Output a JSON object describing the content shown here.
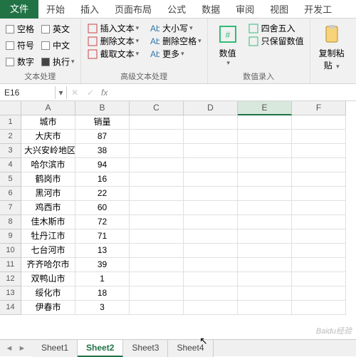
{
  "tabs": {
    "file": "文件",
    "items": [
      "开始",
      "插入",
      "页面布局",
      "公式",
      "数据",
      "审阅",
      "视图",
      "开发工"
    ]
  },
  "ribbon": {
    "g1": {
      "title": "文本处理",
      "checks": [
        {
          "label": "空格",
          "on": false
        },
        {
          "label": "英文",
          "on": false
        },
        {
          "label": "符号",
          "on": false
        },
        {
          "label": "中文",
          "on": false
        },
        {
          "label": "数字",
          "on": false
        },
        {
          "label": "执行",
          "on": true
        }
      ]
    },
    "g2": {
      "title": "高级文本处理",
      "left": [
        "插入文本",
        "删除文本",
        "截取文本"
      ],
      "right": [
        "大小写",
        "删除空格",
        "更多"
      ]
    },
    "g3": {
      "title": "数值录入",
      "big": "数值",
      "items": [
        "四舍五入",
        "只保留数值"
      ]
    },
    "g4": {
      "big1": "复制粘",
      "big2": "贴"
    }
  },
  "namebox": "E16",
  "fx": "fx",
  "cols": [
    "A",
    "B",
    "C",
    "D",
    "E",
    "F"
  ],
  "selected_col": "E",
  "chart_data": {
    "type": "table",
    "headers": [
      "城市",
      "销量"
    ],
    "rows": [
      [
        "大庆市",
        87
      ],
      [
        "大兴安岭地区",
        38
      ],
      [
        "哈尔滨市",
        94
      ],
      [
        "鹤岗市",
        16
      ],
      [
        "黑河市",
        22
      ],
      [
        "鸡西市",
        60
      ],
      [
        "佳木斯市",
        72
      ],
      [
        "牡丹江市",
        71
      ],
      [
        "七台河市",
        13
      ],
      [
        "齐齐哈尔市",
        39
      ],
      [
        "双鸭山市",
        1
      ],
      [
        "绥化市",
        18
      ],
      [
        "伊春市",
        3
      ]
    ]
  },
  "sheets": [
    "Sheet1",
    "Sheet2",
    "Sheet3",
    "Sheet4"
  ],
  "active_sheet": "Sheet2",
  "watermark": "Baidu经验"
}
